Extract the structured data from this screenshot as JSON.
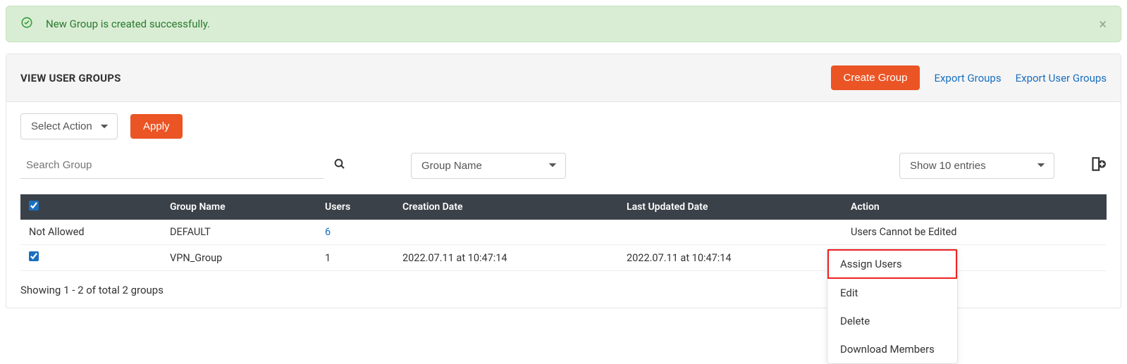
{
  "alert": {
    "message": "New Group is created successfully."
  },
  "panel": {
    "title": "VIEW USER GROUPS",
    "createButton": "Create Group",
    "exportGroups": "Export Groups",
    "exportUserGroups": "Export User Groups"
  },
  "toolbar": {
    "selectAction": "Select Action",
    "apply": "Apply"
  },
  "search": {
    "placeholder": "Search Group",
    "filterBy": "Group Name",
    "entries": "Show 10 entries"
  },
  "table": {
    "headers": {
      "group": "Group Name",
      "users": "Users",
      "created": "Creation Date",
      "updated": "Last Updated Date",
      "action": "Action"
    },
    "rows": [
      {
        "checkText": "Not Allowed",
        "group": "DEFAULT",
        "users": "6",
        "created": "",
        "updated": "",
        "action": "Users Cannot be Edited"
      },
      {
        "checkText": "",
        "group": "VPN_Group",
        "users": "1",
        "created": "2022.07.11 at 10:47:14",
        "updated": "2022.07.11 at 10:47:14",
        "action": ""
      }
    ]
  },
  "footer": "Showing 1 - 2 of total 2 groups",
  "actionMenu": {
    "assign": "Assign Users",
    "edit": "Edit",
    "delete": "Delete",
    "download": "Download Members"
  }
}
